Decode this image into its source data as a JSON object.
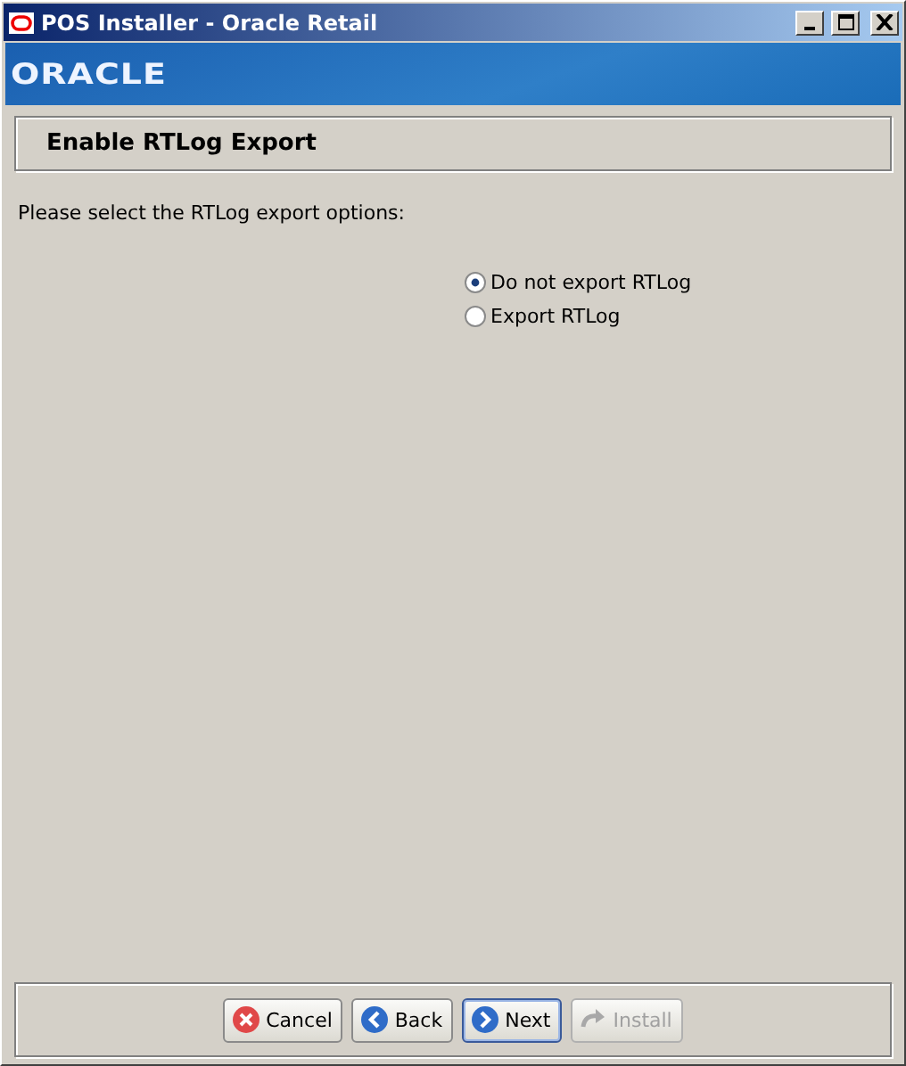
{
  "window": {
    "title": "POS Installer - Oracle Retail"
  },
  "banner": {
    "logo": "ORACLE"
  },
  "header": {
    "title": "Enable RTLog Export"
  },
  "prompt": "Please select the RTLog export options:",
  "options": [
    {
      "label": "Do not export RTLog",
      "selected": true
    },
    {
      "label": "Export RTLog",
      "selected": false
    }
  ],
  "buttons": [
    {
      "label": "Cancel",
      "kind": "cancel",
      "disabled": false,
      "focused": false
    },
    {
      "label": "Back",
      "kind": "back",
      "disabled": false,
      "focused": false
    },
    {
      "label": "Next",
      "kind": "next",
      "disabled": false,
      "focused": true
    },
    {
      "label": "Install",
      "kind": "install",
      "disabled": true,
      "focused": false
    }
  ]
}
